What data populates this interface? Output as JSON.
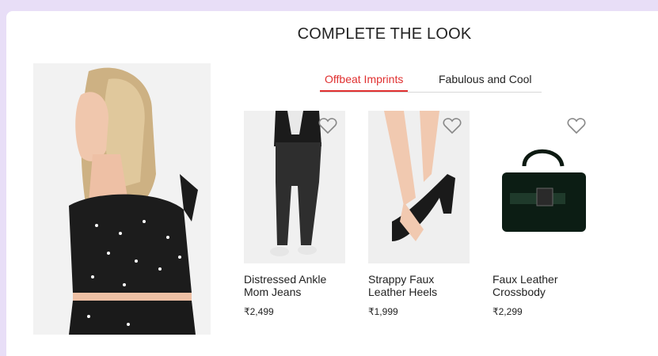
{
  "section_title": "COMPLETE THE LOOK",
  "tabs": [
    {
      "label": "Offbeat Imprints",
      "active": true
    },
    {
      "label": "Fabulous and Cool",
      "active": false
    }
  ],
  "products": [
    {
      "name": "Distressed Ankle Mom Jeans",
      "price": "₹2,499",
      "icon": "heart-icon"
    },
    {
      "name": "Strappy Faux Leather Heels",
      "price": "₹1,999",
      "icon": "heart-icon"
    },
    {
      "name": "Faux Leather Crossbody",
      "price": "₹2,299",
      "icon": "heart-icon"
    }
  ],
  "colors": {
    "background": "#e8def7",
    "accent": "#e03030",
    "text": "#222222"
  }
}
